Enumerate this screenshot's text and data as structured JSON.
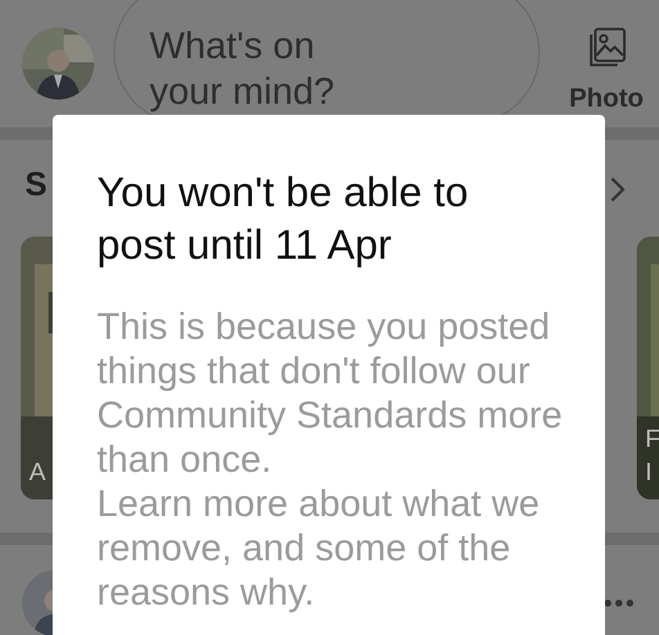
{
  "composer": {
    "placeholder": "What's on your mind?",
    "photo_label": "Photo"
  },
  "stories": {
    "heading": "S",
    "cards": [
      {
        "label": "A"
      },
      {
        "label": "F\nI"
      }
    ]
  },
  "dialog": {
    "title": "You won't be able to post until 11 Apr",
    "message": "This is because you posted things that don't follow our Community Standards more than once.",
    "link": "Learn more about what we remove, and some of the reasons why."
  }
}
